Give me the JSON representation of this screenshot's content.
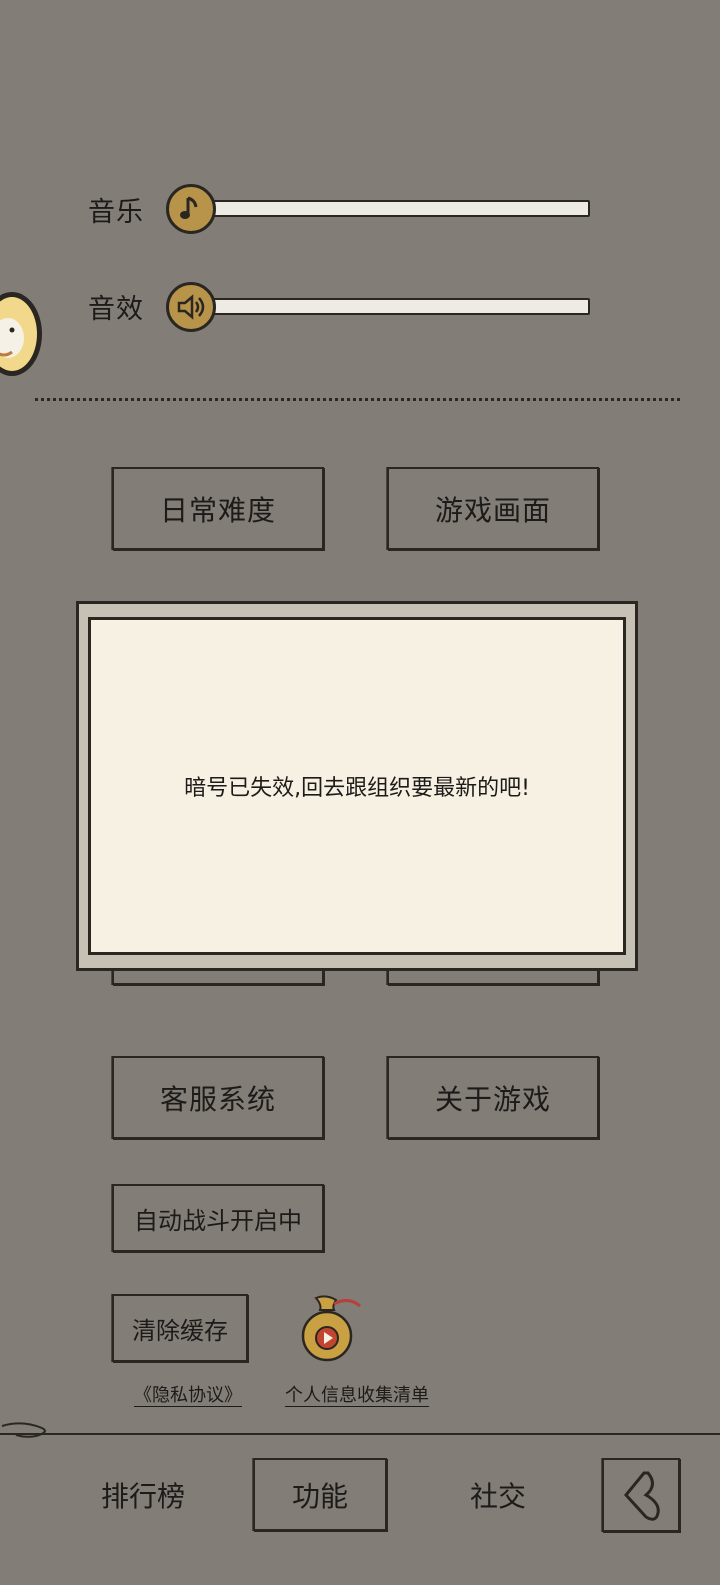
{
  "audio": {
    "music_label": "音乐",
    "sfx_label": "音效",
    "music_level": 0,
    "sfx_level": 0
  },
  "buttons": {
    "daily_difficulty": "日常难度",
    "game_display": "游戏画面",
    "customer_service": "客服系统",
    "about_game": "关于游戏",
    "auto_battle": "自动战斗开启中",
    "clear_cache": "清除缓存"
  },
  "links": {
    "privacy": "《隐私协议》",
    "info_list": "个人信息收集清单"
  },
  "dialog": {
    "message": "暗号已失效,回去跟组织要最新的吧!"
  },
  "bottom_nav": {
    "rankings": "排行榜",
    "functions": "功能",
    "social": "社交"
  },
  "icons": {
    "music": "music-note-icon",
    "sfx": "speaker-icon",
    "side_avatar": "chick-avatar-icon",
    "bag": "lucky-bag-video-icon",
    "back": "back-arrow-icon"
  },
  "colors": {
    "background": "#827d77",
    "knob": "#b8944b",
    "dialog_paper": "#f7f1e3",
    "ink": "#2a2622"
  }
}
